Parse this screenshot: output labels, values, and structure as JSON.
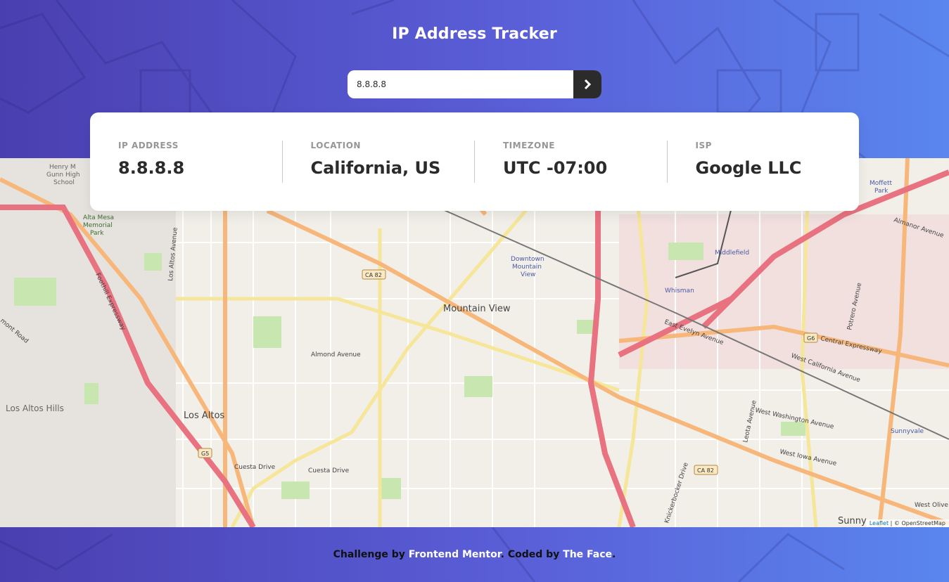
{
  "header": {
    "title": "IP Address Tracker"
  },
  "search": {
    "value": "8.8.8.8",
    "submit_icon": "chevron-right-icon"
  },
  "info": {
    "ip_label": "IP ADDRESS",
    "ip_value": "8.8.8.8",
    "location_label": "LOCATION",
    "location_value": "California, US",
    "timezone_label": "TIMEZONE",
    "timezone_value": "UTC -07:00",
    "isp_label": "ISP",
    "isp_value": "Google LLC"
  },
  "map": {
    "labels": {
      "mountain_view": "Mountain View",
      "los_altos": "Los Altos",
      "los_altos_hills": "Los Altos Hills",
      "downtown_1": "Downtown",
      "downtown_2": "Mountain",
      "downtown_3": "View",
      "middlefield": "Middlefield",
      "whisman": "Whisman",
      "sunnyvale": "Sunnyvale",
      "moffett_1": "Moffett",
      "moffett_2": "Park",
      "altamesa_1": "Alta Mesa",
      "altamesa_2": "Memorial",
      "altamesa_3": "Park",
      "henry_1": "Henry M",
      "henry_2": "Gunn High",
      "henry_3": "School",
      "foothill": "Foothill Expressway",
      "almond": "Almond Avenue",
      "cuesta_1": "Cuesta Drive",
      "cuesta_2": "Cuesta Drive",
      "east_evelyn": "East Evelyn Avenue",
      "central_expwy": "Central Expressway",
      "west_california": "West California Avenue",
      "west_washington": "West Washington Avenue",
      "west_iowa": "West Iowa Avenue",
      "almanor": "Almanor Avenue",
      "knickerbocker": "Knickerbocker Drive",
      "potrero": "Potrero Avenue",
      "leota": "Leota Avenue",
      "los_altos_ave": "Los Altos Avenue",
      "mont_road": "mont Road",
      "west_olive": "West Olive",
      "sunny_partial": "Sunny",
      "ca82_1": "CA 82",
      "ca82_2": "CA 82",
      "g5": "G5",
      "g6": "G6"
    },
    "attribution_leaflet": "Leaflet",
    "attribution_osm": "| © OpenStreetMap"
  },
  "footer": {
    "prefix": "Challenge by ",
    "link1": "Frontend Mentor",
    "middle": ". Coded by ",
    "link2": "The Face",
    "suffix": "."
  },
  "colors": {
    "accent": "#2b2b2b",
    "label_gray": "#969696",
    "bg_gradient_start": "#4a3fb0",
    "bg_gradient_end": "#5a86ee"
  }
}
